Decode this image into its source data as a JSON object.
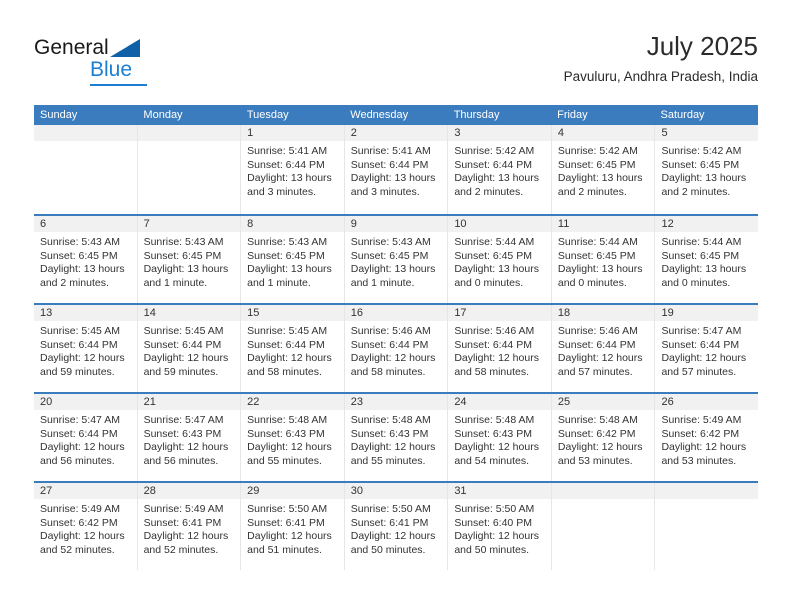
{
  "brand": {
    "name_top": "General",
    "name_bottom": "Blue",
    "triangle_color": "#1060a8",
    "blue_color": "#1c7fd4"
  },
  "header": {
    "title": "July 2025",
    "subtitle": "Pavuluru, Andhra Pradesh, India"
  },
  "theme": {
    "header_bar": "#3b7cbe",
    "day_banner": "#f1f1f1",
    "cell_divider": "#e6e6e6",
    "text": "#333333"
  },
  "weekday_headers": [
    "Sunday",
    "Monday",
    "Tuesday",
    "Wednesday",
    "Thursday",
    "Friday",
    "Saturday"
  ],
  "labels": {
    "sunrise_prefix": "Sunrise:",
    "sunset_prefix": "Sunset:",
    "daylight_prefix": "Daylight:"
  },
  "weeks": [
    {
      "days": [
        {
          "day": "",
          "sunrise": "",
          "sunset": "",
          "daylight_line1": "",
          "daylight_line2": "",
          "empty": true
        },
        {
          "day": "",
          "sunrise": "",
          "sunset": "",
          "daylight_line1": "",
          "daylight_line2": "",
          "empty": true
        },
        {
          "day": "1",
          "sunrise": "Sunrise: 5:41 AM",
          "sunset": "Sunset: 6:44 PM",
          "daylight_line1": "Daylight: 13 hours",
          "daylight_line2": "and 3 minutes.",
          "empty": false
        },
        {
          "day": "2",
          "sunrise": "Sunrise: 5:41 AM",
          "sunset": "Sunset: 6:44 PM",
          "daylight_line1": "Daylight: 13 hours",
          "daylight_line2": "and 3 minutes.",
          "empty": false
        },
        {
          "day": "3",
          "sunrise": "Sunrise: 5:42 AM",
          "sunset": "Sunset: 6:44 PM",
          "daylight_line1": "Daylight: 13 hours",
          "daylight_line2": "and 2 minutes.",
          "empty": false
        },
        {
          "day": "4",
          "sunrise": "Sunrise: 5:42 AM",
          "sunset": "Sunset: 6:45 PM",
          "daylight_line1": "Daylight: 13 hours",
          "daylight_line2": "and 2 minutes.",
          "empty": false
        },
        {
          "day": "5",
          "sunrise": "Sunrise: 5:42 AM",
          "sunset": "Sunset: 6:45 PM",
          "daylight_line1": "Daylight: 13 hours",
          "daylight_line2": "and 2 minutes.",
          "empty": false
        }
      ]
    },
    {
      "days": [
        {
          "day": "6",
          "sunrise": "Sunrise: 5:43 AM",
          "sunset": "Sunset: 6:45 PM",
          "daylight_line1": "Daylight: 13 hours",
          "daylight_line2": "and 2 minutes.",
          "empty": false
        },
        {
          "day": "7",
          "sunrise": "Sunrise: 5:43 AM",
          "sunset": "Sunset: 6:45 PM",
          "daylight_line1": "Daylight: 13 hours",
          "daylight_line2": "and 1 minute.",
          "empty": false
        },
        {
          "day": "8",
          "sunrise": "Sunrise: 5:43 AM",
          "sunset": "Sunset: 6:45 PM",
          "daylight_line1": "Daylight: 13 hours",
          "daylight_line2": "and 1 minute.",
          "empty": false
        },
        {
          "day": "9",
          "sunrise": "Sunrise: 5:43 AM",
          "sunset": "Sunset: 6:45 PM",
          "daylight_line1": "Daylight: 13 hours",
          "daylight_line2": "and 1 minute.",
          "empty": false
        },
        {
          "day": "10",
          "sunrise": "Sunrise: 5:44 AM",
          "sunset": "Sunset: 6:45 PM",
          "daylight_line1": "Daylight: 13 hours",
          "daylight_line2": "and 0 minutes.",
          "empty": false
        },
        {
          "day": "11",
          "sunrise": "Sunrise: 5:44 AM",
          "sunset": "Sunset: 6:45 PM",
          "daylight_line1": "Daylight: 13 hours",
          "daylight_line2": "and 0 minutes.",
          "empty": false
        },
        {
          "day": "12",
          "sunrise": "Sunrise: 5:44 AM",
          "sunset": "Sunset: 6:45 PM",
          "daylight_line1": "Daylight: 13 hours",
          "daylight_line2": "and 0 minutes.",
          "empty": false
        }
      ]
    },
    {
      "days": [
        {
          "day": "13",
          "sunrise": "Sunrise: 5:45 AM",
          "sunset": "Sunset: 6:44 PM",
          "daylight_line1": "Daylight: 12 hours",
          "daylight_line2": "and 59 minutes.",
          "empty": false
        },
        {
          "day": "14",
          "sunrise": "Sunrise: 5:45 AM",
          "sunset": "Sunset: 6:44 PM",
          "daylight_line1": "Daylight: 12 hours",
          "daylight_line2": "and 59 minutes.",
          "empty": false
        },
        {
          "day": "15",
          "sunrise": "Sunrise: 5:45 AM",
          "sunset": "Sunset: 6:44 PM",
          "daylight_line1": "Daylight: 12 hours",
          "daylight_line2": "and 58 minutes.",
          "empty": false
        },
        {
          "day": "16",
          "sunrise": "Sunrise: 5:46 AM",
          "sunset": "Sunset: 6:44 PM",
          "daylight_line1": "Daylight: 12 hours",
          "daylight_line2": "and 58 minutes.",
          "empty": false
        },
        {
          "day": "17",
          "sunrise": "Sunrise: 5:46 AM",
          "sunset": "Sunset: 6:44 PM",
          "daylight_line1": "Daylight: 12 hours",
          "daylight_line2": "and 58 minutes.",
          "empty": false
        },
        {
          "day": "18",
          "sunrise": "Sunrise: 5:46 AM",
          "sunset": "Sunset: 6:44 PM",
          "daylight_line1": "Daylight: 12 hours",
          "daylight_line2": "and 57 minutes.",
          "empty": false
        },
        {
          "day": "19",
          "sunrise": "Sunrise: 5:47 AM",
          "sunset": "Sunset: 6:44 PM",
          "daylight_line1": "Daylight: 12 hours",
          "daylight_line2": "and 57 minutes.",
          "empty": false
        }
      ]
    },
    {
      "days": [
        {
          "day": "20",
          "sunrise": "Sunrise: 5:47 AM",
          "sunset": "Sunset: 6:44 PM",
          "daylight_line1": "Daylight: 12 hours",
          "daylight_line2": "and 56 minutes.",
          "empty": false
        },
        {
          "day": "21",
          "sunrise": "Sunrise: 5:47 AM",
          "sunset": "Sunset: 6:43 PM",
          "daylight_line1": "Daylight: 12 hours",
          "daylight_line2": "and 56 minutes.",
          "empty": false
        },
        {
          "day": "22",
          "sunrise": "Sunrise: 5:48 AM",
          "sunset": "Sunset: 6:43 PM",
          "daylight_line1": "Daylight: 12 hours",
          "daylight_line2": "and 55 minutes.",
          "empty": false
        },
        {
          "day": "23",
          "sunrise": "Sunrise: 5:48 AM",
          "sunset": "Sunset: 6:43 PM",
          "daylight_line1": "Daylight: 12 hours",
          "daylight_line2": "and 55 minutes.",
          "empty": false
        },
        {
          "day": "24",
          "sunrise": "Sunrise: 5:48 AM",
          "sunset": "Sunset: 6:43 PM",
          "daylight_line1": "Daylight: 12 hours",
          "daylight_line2": "and 54 minutes.",
          "empty": false
        },
        {
          "day": "25",
          "sunrise": "Sunrise: 5:48 AM",
          "sunset": "Sunset: 6:42 PM",
          "daylight_line1": "Daylight: 12 hours",
          "daylight_line2": "and 53 minutes.",
          "empty": false
        },
        {
          "day": "26",
          "sunrise": "Sunrise: 5:49 AM",
          "sunset": "Sunset: 6:42 PM",
          "daylight_line1": "Daylight: 12 hours",
          "daylight_line2": "and 53 minutes.",
          "empty": false
        }
      ]
    },
    {
      "days": [
        {
          "day": "27",
          "sunrise": "Sunrise: 5:49 AM",
          "sunset": "Sunset: 6:42 PM",
          "daylight_line1": "Daylight: 12 hours",
          "daylight_line2": "and 52 minutes.",
          "empty": false
        },
        {
          "day": "28",
          "sunrise": "Sunrise: 5:49 AM",
          "sunset": "Sunset: 6:41 PM",
          "daylight_line1": "Daylight: 12 hours",
          "daylight_line2": "and 52 minutes.",
          "empty": false
        },
        {
          "day": "29",
          "sunrise": "Sunrise: 5:50 AM",
          "sunset": "Sunset: 6:41 PM",
          "daylight_line1": "Daylight: 12 hours",
          "daylight_line2": "and 51 minutes.",
          "empty": false
        },
        {
          "day": "30",
          "sunrise": "Sunrise: 5:50 AM",
          "sunset": "Sunset: 6:41 PM",
          "daylight_line1": "Daylight: 12 hours",
          "daylight_line2": "and 50 minutes.",
          "empty": false
        },
        {
          "day": "31",
          "sunrise": "Sunrise: 5:50 AM",
          "sunset": "Sunset: 6:40 PM",
          "daylight_line1": "Daylight: 12 hours",
          "daylight_line2": "and 50 minutes.",
          "empty": false
        },
        {
          "day": "",
          "sunrise": "",
          "sunset": "",
          "daylight_line1": "",
          "daylight_line2": "",
          "empty": true
        },
        {
          "day": "",
          "sunrise": "",
          "sunset": "",
          "daylight_line1": "",
          "daylight_line2": "",
          "empty": true
        }
      ]
    }
  ]
}
